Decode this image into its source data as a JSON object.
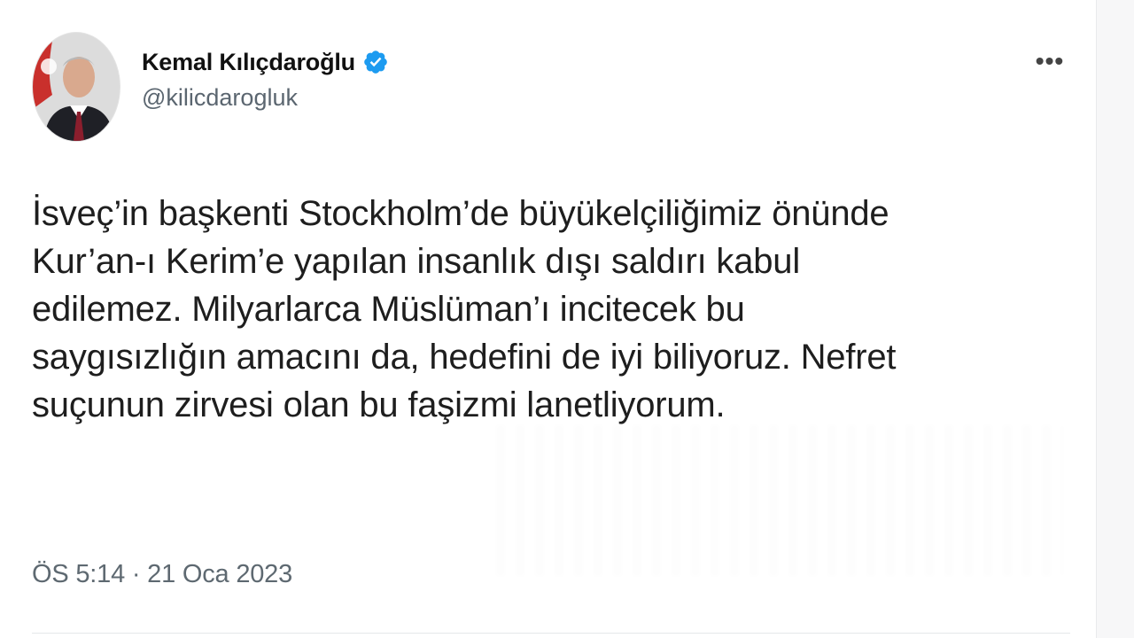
{
  "tweet": {
    "author": {
      "name": "Kemal Kılıçdaroğlu",
      "handle": "@kilicdarogluk",
      "verified": true,
      "verified_color": "#1d9bf0"
    },
    "text_lines": [
      "İsveç’in başkenti Stockholm’de büyükelçiliğimiz önünde",
      "Kur’an-ı Kerim’e yapılan insanlık dışı saldırı kabul",
      "edilemez. Milyarlarca Müslüman’ı incitecek bu",
      "saygısızlığın amacını da, hedefini de iyi biliyoruz. Nefret",
      "suçunun zirvesi olan bu faşizmi lanetliyorum."
    ],
    "timestamp": "ÖS 5:14 · 21 Oca 2023",
    "more_icon": "more-dots-icon"
  }
}
